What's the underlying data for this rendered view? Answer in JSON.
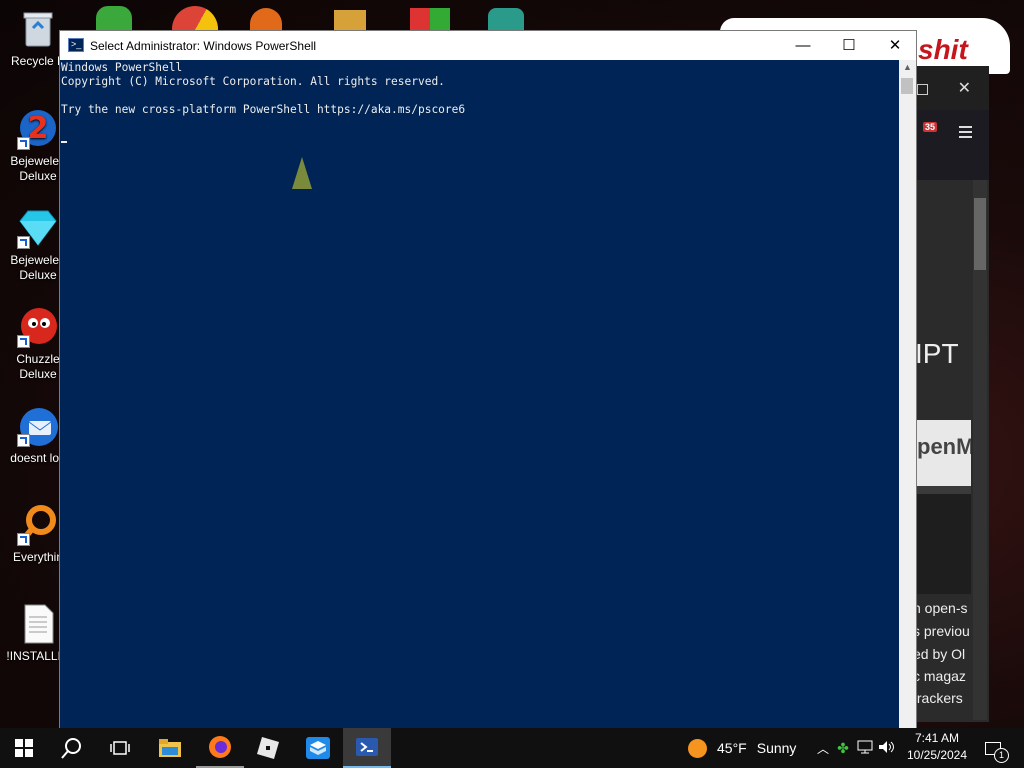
{
  "desktop": {
    "icons": [
      {
        "label": "Recycle B",
        "icon": "recycle-bin-icon"
      },
      {
        "label": "Bejeweled Deluxe",
        "icon": "bejeweled2-icon"
      },
      {
        "label": "Bejeweled Deluxe",
        "icon": "bejeweled-gem-icon"
      },
      {
        "label": "Chuzzle Deluxe",
        "icon": "chuzzle-icon"
      },
      {
        "label": "doesnt loa",
        "icon": "thunderbird-icon"
      },
      {
        "label": "Everythin",
        "icon": "everything-search-icon"
      },
      {
        "label": "!INSTALLIN",
        "icon": "text-document-icon"
      }
    ]
  },
  "bg_window": {
    "logo_text": "shit",
    "notification_count": "35",
    "heading_fragment": "IPT",
    "card_fragment": "penM",
    "text_lines": [
      "n open-s",
      "s previou",
      "ed by Ol",
      "c magaz",
      "trackers"
    ]
  },
  "powershell": {
    "title": "Select Administrator: Windows PowerShell",
    "lines": [
      "Windows PowerShell",
      "Copyright (C) Microsoft Corporation. All rights reserved.",
      "",
      "Try the new cross-platform PowerShell https://aka.ms/pscore6"
    ],
    "minimize_glyph": "—",
    "maximize_glyph": "☐",
    "close_glyph": "✕"
  },
  "taskbar": {
    "apps": [
      "start-icon",
      "search-icon",
      "task-view-icon",
      "file-explorer-icon",
      "firefox-icon",
      "roblox-icon",
      "app-box-icon",
      "powershell-icon"
    ],
    "weather": {
      "temp": "45°F",
      "condition": "Sunny"
    },
    "clock": {
      "time": "7:41 AM",
      "date": "10/25/2024"
    },
    "notifications_count": "1"
  },
  "colors": {
    "console_bg": "#012456",
    "taskbar_bg": "#101010",
    "accent": "#76b9ed"
  }
}
